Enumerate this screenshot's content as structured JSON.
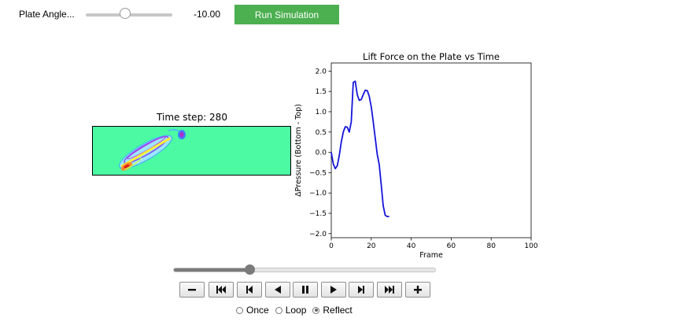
{
  "controls": {
    "angle_label": "Plate Angle...",
    "angle_value": "-10.00",
    "angle_fraction": 0.45,
    "run_button": "Run Simulation"
  },
  "simulation": {
    "time_step_title": "Time step: 280",
    "background_color": "#4cfaa4"
  },
  "chart_data": {
    "type": "line",
    "title": "Lift Force on the Plate vs Time",
    "xlabel": "Frame",
    "ylabel": "ΔPressure (Bottom - Top)",
    "xlim": [
      0,
      100
    ],
    "ylim": [
      -2.1,
      2.2
    ],
    "xticks": [
      0,
      20,
      40,
      60,
      80,
      100
    ],
    "yticks": [
      -2.0,
      -1.5,
      -1.0,
      -0.5,
      0.0,
      0.5,
      1.0,
      1.5,
      2.0
    ],
    "xtick_labels": [
      "0",
      "20",
      "40",
      "60",
      "80",
      "100"
    ],
    "ytick_labels": [
      "−2.0",
      "−1.5",
      "−1.0",
      "−0.5",
      "0.0",
      "0.5",
      "1.0",
      "1.5",
      "2.0"
    ],
    "line_color": "#1515dc",
    "grid": false,
    "series": [
      {
        "x": [
          0,
          1,
          2,
          3,
          4,
          5,
          6,
          7,
          8,
          9,
          10,
          11,
          12,
          13,
          14,
          15,
          16,
          17,
          18,
          19,
          20,
          21,
          22,
          23,
          24,
          25,
          26,
          27,
          28,
          29
        ],
        "y": [
          0.0,
          -0.28,
          -0.4,
          -0.33,
          -0.08,
          0.25,
          0.5,
          0.63,
          0.62,
          0.5,
          0.75,
          1.72,
          1.75,
          1.42,
          1.28,
          1.3,
          1.42,
          1.53,
          1.52,
          1.38,
          1.12,
          0.75,
          0.35,
          -0.05,
          -0.3,
          -0.8,
          -1.32,
          -1.55,
          -1.58,
          -1.58
        ]
      }
    ]
  },
  "player": {
    "progress": 0.29,
    "mode_options": [
      "Once",
      "Loop",
      "Reflect"
    ],
    "selected_mode": "Reflect"
  }
}
